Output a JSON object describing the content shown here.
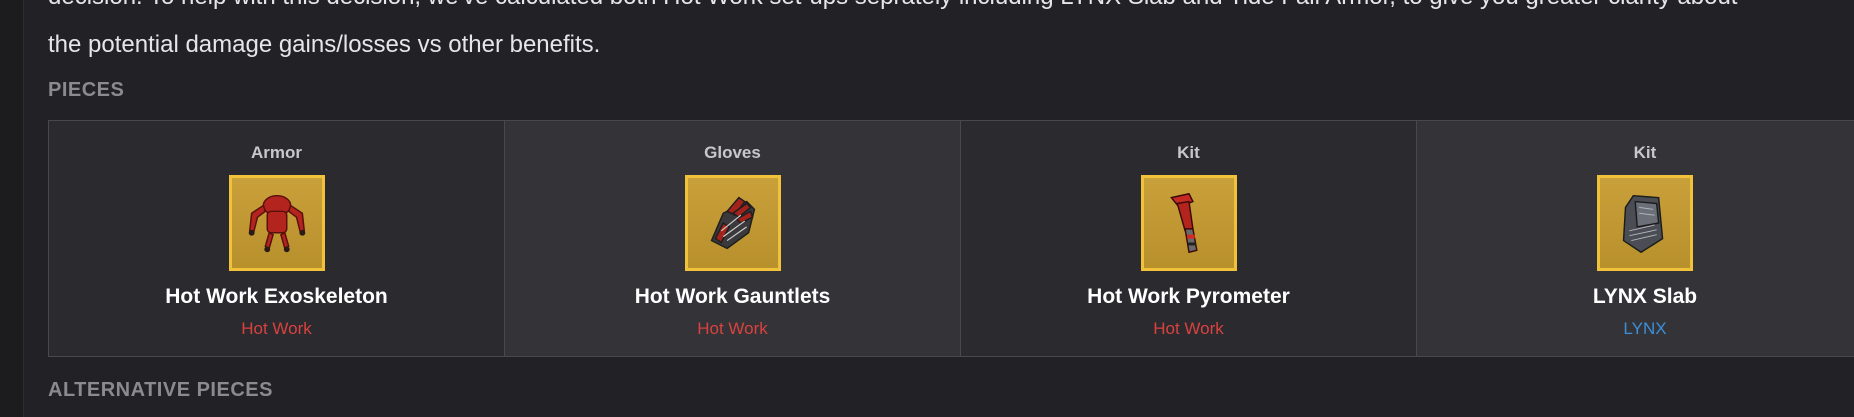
{
  "article": {
    "para_line_1": "decision. To help with this decision, we've calculated both Hot Work set-ups seprately including LYNX Slab and Tide Fall Armor, to give you greater clarity about",
    "para_line_2": "the potential damage gains/losses vs other benefits."
  },
  "sections": {
    "pieces_heading": "PIECES",
    "alternative_heading": "ALTERNATIVE PIECES"
  },
  "pieces": [
    {
      "slot": "Armor",
      "name": "Hot Work Exoskeleton",
      "set": "Hot Work",
      "icon": "exoskeleton-icon",
      "set_color": "#d9423f"
    },
    {
      "slot": "Gloves",
      "name": "Hot Work Gauntlets",
      "set": "Hot Work",
      "icon": "gauntlets-icon",
      "set_color": "#d9423f"
    },
    {
      "slot": "Kit",
      "name": "Hot Work Pyrometer",
      "set": "Hot Work",
      "icon": "pyrometer-icon",
      "set_color": "#d9423f"
    },
    {
      "slot": "Kit",
      "name": "LYNX Slab",
      "set": "LYNX",
      "icon": "slab-icon",
      "set_color": "#3d8fd9"
    }
  ],
  "colors": {
    "background": "#222226",
    "card_border": "#48484e",
    "icon_bg": "#c9a03a",
    "icon_border": "#f2c13a"
  }
}
